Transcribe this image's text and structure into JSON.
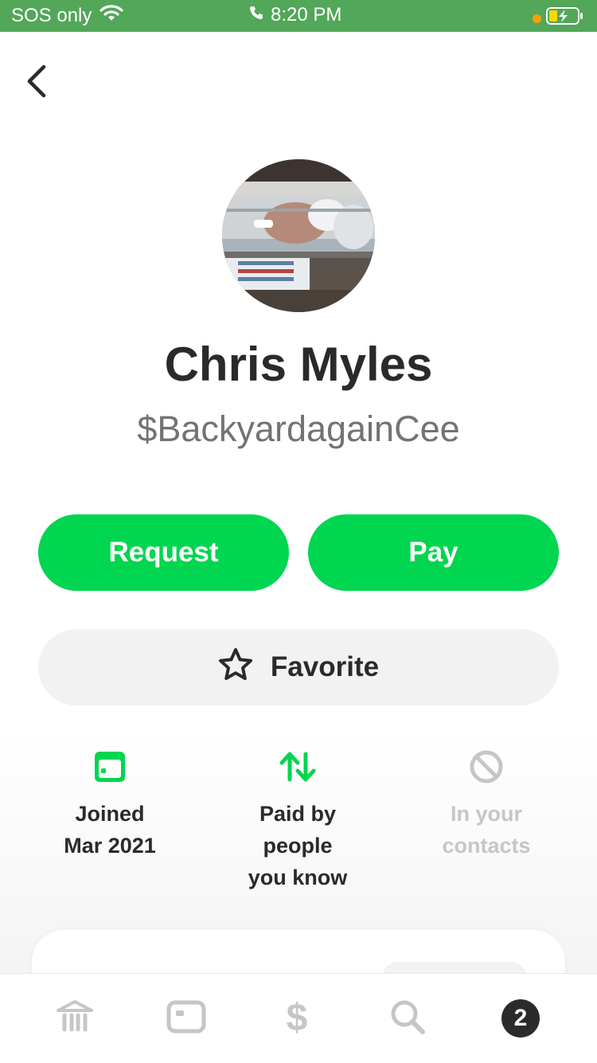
{
  "status_bar": {
    "carrier": "SOS only",
    "time": "8:20 PM"
  },
  "profile": {
    "name": "Chris Myles",
    "cashtag": "$BackyardagainCee"
  },
  "actions": {
    "request_label": "Request",
    "pay_label": "Pay",
    "favorite_label": "Favorite"
  },
  "stats": [
    {
      "icon": "calendar-icon",
      "line1": "Joined",
      "line2": "Mar 2021",
      "line3": ""
    },
    {
      "icon": "transfer-arrows-icon",
      "line1": "Paid by",
      "line2": "people",
      "line3": "you know"
    },
    {
      "icon": "no-entry-icon",
      "line1": "In your",
      "line2": "contacts",
      "line3": ""
    }
  ],
  "tab_bar": {
    "cash_glyph": "$",
    "activity_badge": "2"
  },
  "colors": {
    "status_bar": "#52a758",
    "accent_green": "#00d64f",
    "muted_gray": "#c6c6c6"
  }
}
